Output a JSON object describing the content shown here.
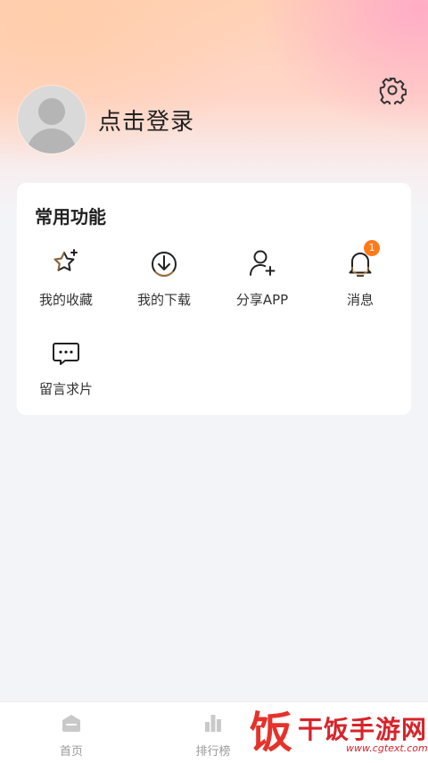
{
  "profile": {
    "login_label": "点击登录"
  },
  "settings": {
    "icon": "gear-icon"
  },
  "common_functions": {
    "title": "常用功能",
    "items": [
      {
        "label": "我的收藏",
        "icon": "star-sparkle-icon"
      },
      {
        "label": "我的下载",
        "icon": "download-circle-icon"
      },
      {
        "label": "分享APP",
        "icon": "user-add-icon"
      },
      {
        "label": "消息",
        "icon": "bell-icon",
        "badge": "1"
      },
      {
        "label": "留言求片",
        "icon": "chat-bubble-icon"
      }
    ]
  },
  "tabbar": {
    "items": [
      {
        "label": "首页",
        "icon": "home-icon"
      },
      {
        "label": "排行榜",
        "icon": "bar-chart-icon"
      }
    ]
  },
  "watermark": {
    "glyph": "饭",
    "text": "干饭手游网",
    "url": "www.cgtext.com"
  },
  "colors": {
    "badge": "#ff7a1a",
    "watermark": "#d8232a"
  }
}
